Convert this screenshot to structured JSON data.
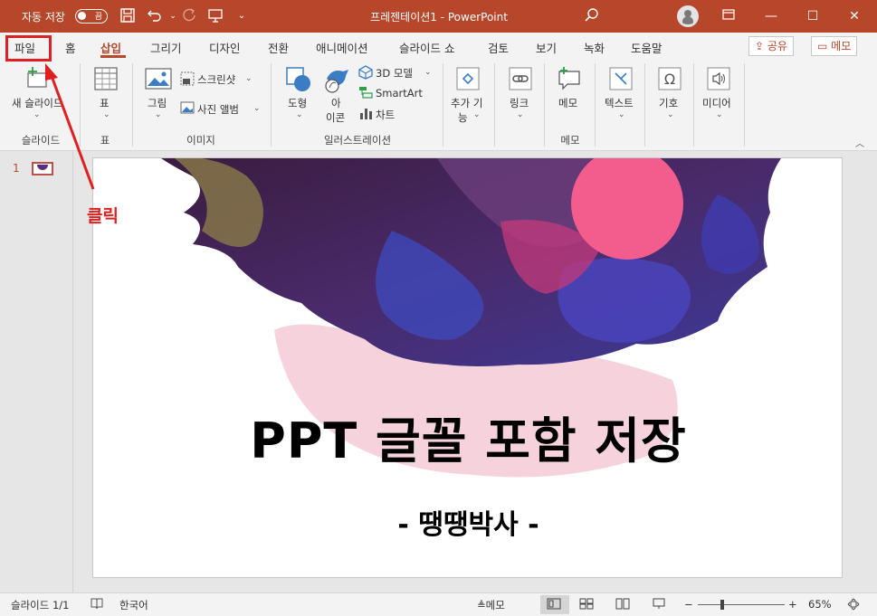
{
  "titlebar": {
    "autosave_label": "자동 저장",
    "autosave_state": "끔",
    "doc_title": "프레젠테이션1  -  PowerPoint"
  },
  "tabs": {
    "items": [
      "파일",
      "홈",
      "삽입",
      "그리기",
      "디자인",
      "전환",
      "애니메이션",
      "슬라이드 쇼",
      "검토",
      "보기",
      "녹화",
      "도움말"
    ],
    "active": "삽입",
    "share": "공유",
    "memo": "메모"
  },
  "ribbon": {
    "new_slide": "새 슬라이드",
    "table": "표",
    "pictures": "그림",
    "screenshot": "스크린샷",
    "photo_album": "사진 앨범",
    "shapes": "도형",
    "icons_l1": "아",
    "icons_l2": "이콘",
    "model3d": "3D 모델",
    "smartart": "SmartArt",
    "chart": "차트",
    "addins_l1": "추가 기",
    "addins_l2": "능",
    "link": "링크",
    "comment": "메모",
    "text": "텍스트",
    "symbols": "기호",
    "media": "미디어",
    "groups": {
      "slides": "슬라이드",
      "tables": "표",
      "images": "이미지",
      "illustrations": "일러스트레이션",
      "comments": "메모"
    }
  },
  "thumbnails": {
    "number": "1"
  },
  "slide": {
    "title": "PPT 글꼴 포함 저장",
    "subtitle": "- 땡땡박사 -"
  },
  "annotation": {
    "text": "클릭",
    "color": "#e02020"
  },
  "status": {
    "slide_count": "슬라이드 1/1",
    "language": "한국어",
    "notes": "메모",
    "zoom": "65%"
  },
  "colors": {
    "accent": "#b7472a",
    "ribbon_bg": "#f3f3f3"
  },
  "icons": [
    "save-icon",
    "undo-icon",
    "redo-icon",
    "customize-icon",
    "search-icon",
    "user-icon",
    "ribbon-display-icon",
    "minimize-icon",
    "maximize-icon",
    "close-icon"
  ]
}
